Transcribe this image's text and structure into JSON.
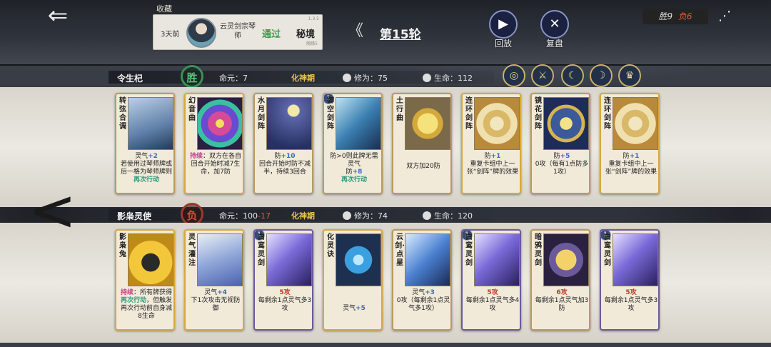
{
  "header": {
    "back_icon": "back-arrow-icon",
    "favorites_label": "收藏",
    "record": {
      "time": "3天前",
      "opponent": "云灵剑宗琴师",
      "result": "通过",
      "mode": "秘境",
      "version": "1.3.5",
      "sub": "随缘5"
    },
    "round_label": "第15轮",
    "replay_label": "回放",
    "review_label": "复盘",
    "score": {
      "win": "胜9",
      "loss": "负6"
    }
  },
  "player1": {
    "name": "令生杞",
    "result": "胜",
    "life_label": "命元：7",
    "realm": "化神期",
    "cultivation": "修为：75",
    "hp": "生命：112"
  },
  "player2": {
    "name": "影枭灵使",
    "result": "负",
    "life_prefix": "命元：100",
    "life_delta": "-17",
    "realm": "化神期",
    "cultivation": "修为：74",
    "hp": "生命：120"
  },
  "row1_cards": [
    {
      "title": "转弦合调",
      "desc_a": "灵气",
      "desc_a_hl": "+2",
      "desc_b": "若使用过琴师牌或后一格为琴师牌则",
      "desc_c": "再次行动"
    },
    {
      "title": "幻音曲",
      "desc_a": "持续",
      "desc_b": "：双方在各自回合开始时减7生命，加7防"
    },
    {
      "title": "水月剑阵",
      "desc_a": "防",
      "desc_a_hl": "+10",
      "desc_b": "回合开始时防不减半，持续3回合"
    },
    {
      "title": "御空剑阵",
      "level": "1",
      "desc_a": "防>0则此牌无需灵气",
      "desc_b": "防",
      "desc_b_hl": "+8",
      "desc_c": "再次行动"
    },
    {
      "title": "土行曲",
      "desc_a": "双方加20防"
    },
    {
      "title": "连环剑阵",
      "desc_a": "防",
      "desc_a_hl": "+1",
      "desc_b": "重复卡组中上一张“剑阵”牌的效果"
    },
    {
      "title": "镜花剑阵",
      "desc_a": "防",
      "desc_a_hl": "+5",
      "desc_b": "0攻（每有1点防多1攻）"
    },
    {
      "title": "连环剑阵",
      "desc_a": "防",
      "desc_a_hl": "+1",
      "desc_b": "重复卡组中上一张“剑阵”牌的效果"
    }
  ],
  "row2_cards": [
    {
      "title": "影枭兔",
      "desc_a": "持续",
      "desc_b": "：所有牌获得",
      "desc_c": "再次行动",
      "desc_d": "，但触发再次行动前自身减8生命"
    },
    {
      "title": "灵气灌注",
      "desc_a": "灵气",
      "desc_a_hl": "+4",
      "desc_b": "下1次攻击无视防御"
    },
    {
      "title": "白鸾灵剑",
      "level": "1",
      "desc_a": "5攻",
      "desc_b": "每剩余1点灵气多3攻"
    },
    {
      "title": "化灵诀",
      "desc_a": "灵气",
      "desc_a_hl": "+5"
    },
    {
      "title": "云剑·点星",
      "desc_a": "灵气",
      "desc_a_hl": "+3",
      "desc_b": "0攻（每剩余1点灵气多1攻）"
    },
    {
      "title": "白鸾灵剑",
      "level": "1",
      "desc_a": "5攻",
      "desc_b": "每剩余1点灵气多4攻"
    },
    {
      "title": "暗鸦灵剑",
      "desc_a": "6攻",
      "desc_b": "每剩余1点灵气加3防"
    },
    {
      "title": "白鸾灵剑",
      "level": "1",
      "desc_a": "5攻",
      "desc_b": "每剩余1点灵气多3攻"
    }
  ],
  "boss_icons": [
    "swirl-icon",
    "blade-icon",
    "moon-icon",
    "crescent-icon",
    "mask-icon"
  ],
  "colors": {
    "accent_gold": "#e9c34c",
    "win_green": "#58c47a",
    "loss_red": "#e14a33"
  }
}
